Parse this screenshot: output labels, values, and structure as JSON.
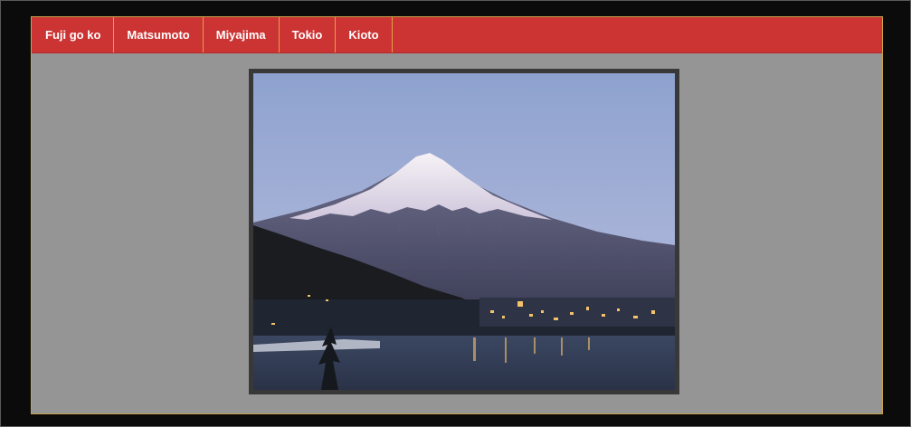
{
  "nav": {
    "items": [
      {
        "label": "Fuji go ko"
      },
      {
        "label": "Matsumoto"
      },
      {
        "label": "Miyajima"
      },
      {
        "label": "Tokio"
      },
      {
        "label": "Kioto"
      }
    ]
  },
  "photo": {
    "subject": "Mount Fuji at dusk over lake with town lights"
  },
  "colors": {
    "nav_background": "#cc3333",
    "content_background": "#959595",
    "page_background": "#0b0b0b",
    "nav_divider": "#e2a04a"
  }
}
